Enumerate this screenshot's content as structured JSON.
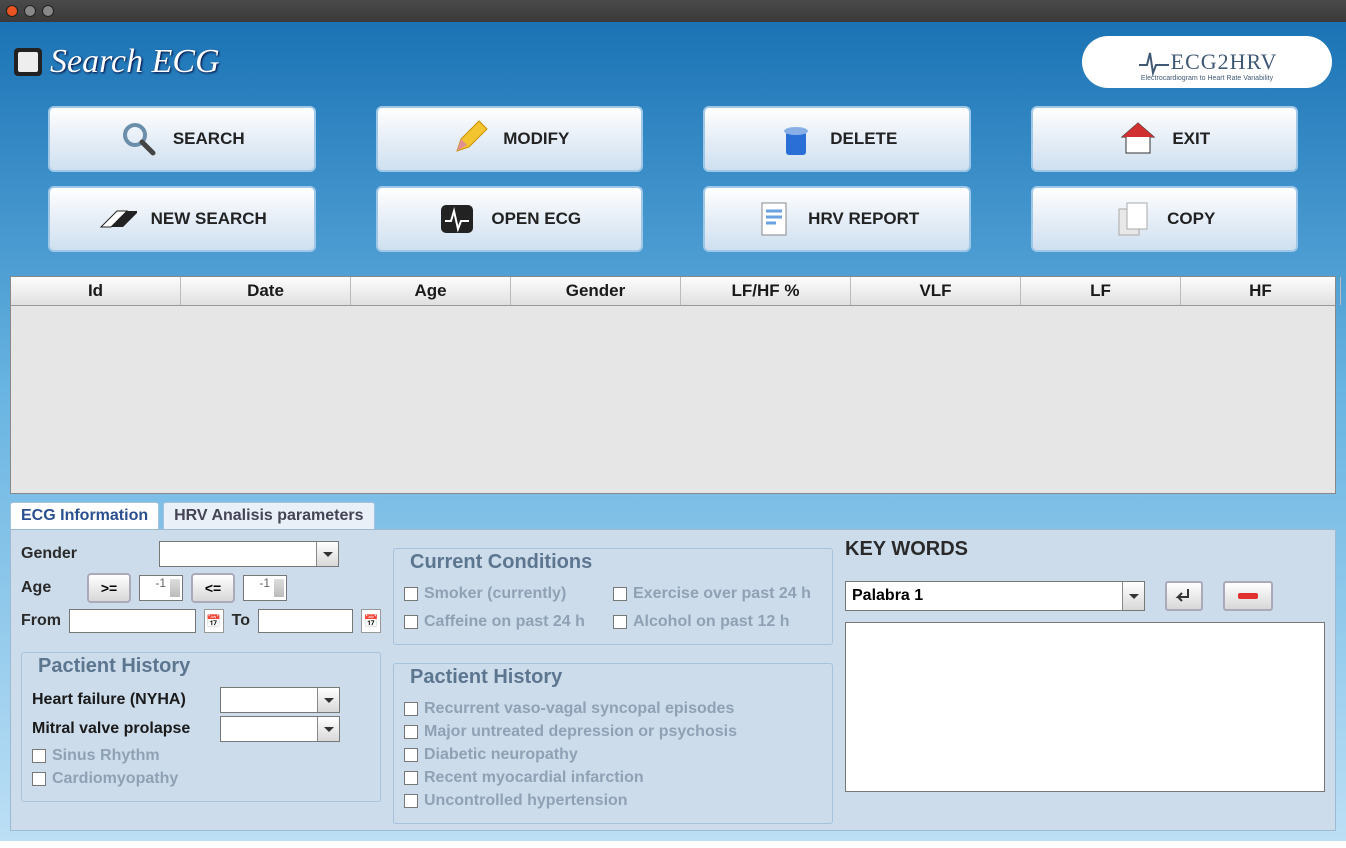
{
  "app": {
    "title": "Search ECG",
    "logo_text": "ECG2HRV",
    "logo_sub": "Electrocardiogram to Heart Rate Variability"
  },
  "toolbar": {
    "search": "SEARCH",
    "modify": "MODIFY",
    "delete": "DELETE",
    "exit": "EXIT",
    "new_search": "NEW SEARCH",
    "open_ecg": "OPEN ECG",
    "hrv_report": "HRV REPORT",
    "copy": "COPY"
  },
  "table": {
    "headers": [
      "Id",
      "Date",
      "Age",
      "Gender",
      "LF/HF %",
      "VLF",
      "LF",
      "HF"
    ]
  },
  "tabs": {
    "ecg_info": "ECG Information",
    "hrv_params": "HRV Analisis parameters"
  },
  "filters": {
    "gender_label": "Gender",
    "age_label": "Age",
    "btn_ge": ">=",
    "btn_le": "<=",
    "age_from_value": "-1",
    "age_to_value": "-1",
    "from_label": "From",
    "to_label": "To",
    "patient_history_title": "Pactient History",
    "heart_failure_label": "Heart failure (NYHA)",
    "mitral_label": "Mitral valve prolapse",
    "sinus": "Sinus Rhythm",
    "cardiomyopathy": "Cardiomyopathy"
  },
  "conditions": {
    "title": "Current Conditions",
    "smoker": "Smoker (currently)",
    "exercise": "Exercise over past 24 h",
    "caffeine": "Caffeine on past 24 h",
    "alcohol": "Alcohol on past 12 h",
    "history_title": "Pactient History",
    "vasovagal": "Recurrent vaso-vagal syncopal episodes",
    "depression": "Major untreated depression or psychosis",
    "diabetic": "Diabetic neuropathy",
    "mi": "Recent myocardial infarction",
    "hypertension": "Uncontrolled hypertension"
  },
  "keywords": {
    "title": "KEY WORDS",
    "selected": "Palabra 1"
  }
}
